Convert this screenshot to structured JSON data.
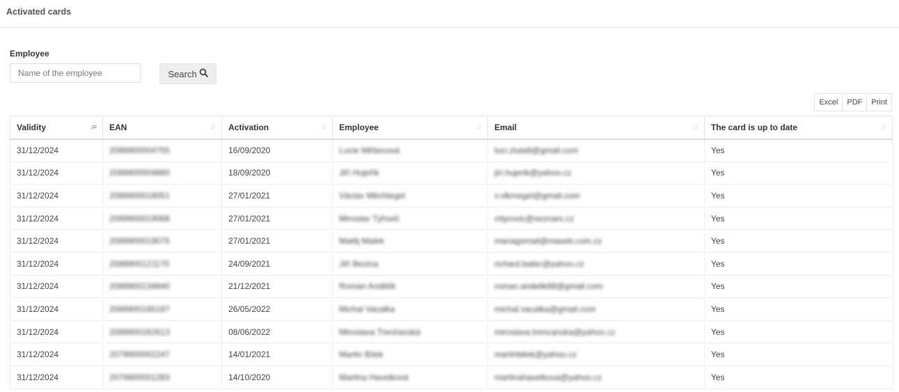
{
  "page": {
    "title": "Activated cards"
  },
  "filter": {
    "label": "Employee",
    "placeholder": "Name of the employee",
    "search_label": "Search"
  },
  "exports": [
    "Excel",
    "PDF",
    "Print"
  ],
  "table": {
    "columns": [
      "Validity",
      "EAN",
      "Activation",
      "Employee",
      "Email",
      "The card is up to date"
    ],
    "rows": [
      [
        "31/12/2024",
        "2089900004755",
        "16/09/2020",
        "Lucie Měšecová",
        "luci.zluta8@gmail.com",
        "Yes"
      ],
      [
        "31/12/2024",
        "2089900004880",
        "18/09/2020",
        "Jiří Hujeřík",
        "jiri.hujerik@yahoo.cz",
        "Yes"
      ],
      [
        "31/12/2024",
        "2089900018051",
        "27/01/2021",
        "Václav Měchtegel",
        "v.vlkmegel@gmail.com",
        "Yes"
      ],
      [
        "31/12/2024",
        "2089900019068",
        "27/01/2021",
        "Miroslav Týřovič",
        "mtyrovic@seznam.cz",
        "Yes"
      ],
      [
        "31/12/2024",
        "2089900019075",
        "27/01/2021",
        "Matěj Malek",
        "managsmail@maxeb.com.cz",
        "Yes"
      ],
      [
        "31/12/2024",
        "2089900121170",
        "24/09/2021",
        "Jiří Bezina",
        "richard.babic@yahoo.cz",
        "Yes"
      ],
      [
        "31/12/2024",
        "2089900134840",
        "21/12/2021",
        "Roman Andělík",
        "roman.andelik88@gmail.com",
        "Yes"
      ],
      [
        "31/12/2024",
        "2089900165197",
        "26/05/2022",
        "Michal Vacalka",
        "michal.vacalka@gmail.com",
        "Yes"
      ],
      [
        "31/12/2024",
        "2089900162613",
        "08/06/2022",
        "Miroslava Trenčanská",
        "miroslava.trencanska@yahoo.cz",
        "Yes"
      ],
      [
        "31/12/2024",
        "2079900002247",
        "14/01/2021",
        "Martin Bílek",
        "martinbilek@yahoo.cz",
        "Yes"
      ],
      [
        "31/12/2024",
        "2079900001283",
        "14/10/2020",
        "Martina Havelková",
        "martinahavelkova@yahoo.cz",
        "Yes"
      ]
    ]
  }
}
